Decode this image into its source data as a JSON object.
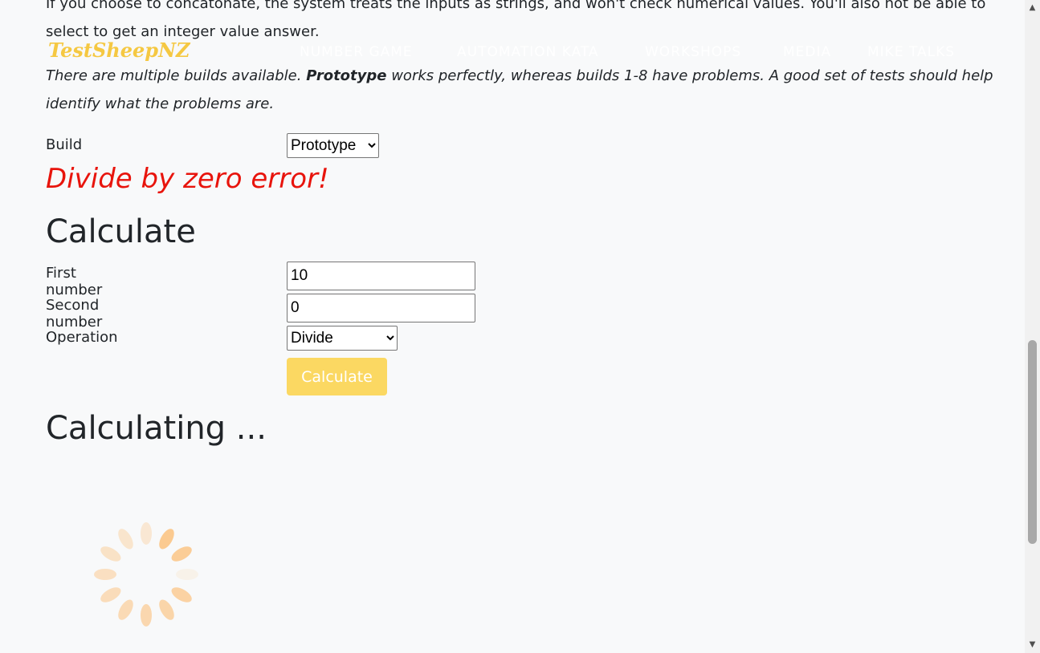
{
  "intro": {
    "line1": "If you choose to concatonate, the system treats the inputs as strings, and won't check numerical values. You'll also not be able to",
    "line2": "select to get an integer value answer.",
    "builds_text_1": "There are multiple builds available. ",
    "builds_bold": "Prototype",
    "builds_text_2": " works perfectly, whereas builds 1-8 have problems. A good set of tests should help",
    "builds_text_3": "identify what the problems are."
  },
  "navbar": {
    "brand": "TestSheepNZ",
    "links": [
      "NUMBER GAME",
      "AUTOMATION KATA",
      "WORKSHOPS",
      "MEDIA",
      "MIKE TALKS"
    ]
  },
  "build": {
    "label": "Build",
    "selected": "Prototype"
  },
  "error_message": "Divide by zero error!",
  "calculate": {
    "heading": "Calculate",
    "first_label": "First number",
    "first_value": "10",
    "second_label": "Second number",
    "second_value": "0",
    "operation_label": "Operation",
    "operation_selected": "Divide",
    "button_label": "Calculate"
  },
  "status_heading": "Calculating ...",
  "colors": {
    "brand": "#f5c842",
    "error": "#e8140c",
    "button": "#fbd862",
    "spinner": "#fbc78a"
  },
  "icons": {
    "spinner": "loading-spinner-icon"
  }
}
